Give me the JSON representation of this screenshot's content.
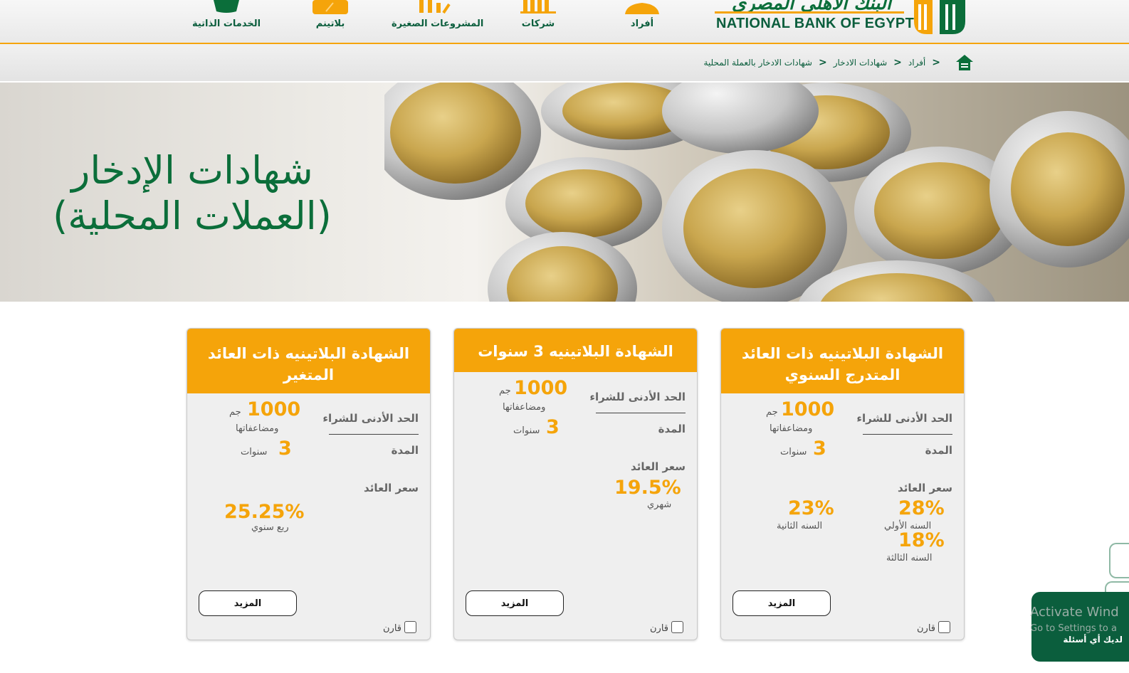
{
  "nav": {
    "items": [
      {
        "label": "الخدمات الذاتية",
        "icon": "self-service-icon"
      },
      {
        "label": "بلاتينم",
        "icon": "platinum-icon"
      },
      {
        "label": "المشروعات الصغيرة",
        "icon": "small-business-icon"
      },
      {
        "label": "شركات",
        "icon": "corporate-icon"
      },
      {
        "label": "أفراد",
        "icon": "personal-icon"
      }
    ]
  },
  "logo": {
    "arabic": "البنك الأهلي المصري",
    "english": "NATIONAL BANK OF EGYPT"
  },
  "breadcrumb": {
    "items": [
      "أفراد",
      "شهادات الادخار",
      "شهادات الادخار بالعملة المحلية"
    ],
    "separator": ">"
  },
  "hero": {
    "title_line1": "شهادات الإدخار",
    "title_line2": "(العملات المحلية)"
  },
  "cards": [
    {
      "title_line1": "الشهادة البلاتينيه ذات العائد",
      "title_line2": "المتدرج السنوي",
      "min_label": "الحد الأدنى للشراء",
      "min_value": "1000",
      "min_unit": "جم",
      "min_note": "ومضاعفاتها",
      "term_label": "المدة",
      "term_value": "3",
      "term_unit": "سنوات",
      "rate_label": "سعر العائد",
      "rates": [
        {
          "value": "28%",
          "note": "السنه الأولي"
        },
        {
          "value": "23%",
          "note": "السنه الثانية"
        },
        {
          "value": "18%",
          "note": "السنه الثالثة"
        }
      ],
      "more_label": "المزيد",
      "compare_label": "قارن"
    },
    {
      "title_line1": "الشهادة البلاتينيه 3 سنوات",
      "title_line2": "",
      "min_label": "الحد الأدنى للشراء",
      "min_value": "1000",
      "min_unit": "جم",
      "min_note": "ومضاعفاتها",
      "term_label": "المدة",
      "term_value": "3",
      "term_unit": "سنوات",
      "rate_label": "سعر العائد",
      "rates": [
        {
          "value": "19.5%",
          "note": "شهري"
        }
      ],
      "more_label": "المزيد",
      "compare_label": "قارن"
    },
    {
      "title_line1": "الشهادة البلاتينيه ذات العائد",
      "title_line2": "المتغير",
      "min_label": "الحد الأدنى للشراء",
      "min_value": "1000",
      "min_unit": "جم",
      "min_note": "ومضاعفاتها",
      "term_label": "المدة",
      "term_value": "3",
      "term_unit": "سنوات",
      "rate_label": "سعر العائد",
      "rates": [
        {
          "value": "25.25%",
          "note": "ربع سنوي"
        }
      ],
      "more_label": "المزيد",
      "compare_label": "قارن"
    }
  ],
  "chat": {
    "label": "لديك أي أسئلة"
  },
  "watermark": {
    "line1": "Activate Wind",
    "line2": "Go to Settings to a"
  },
  "colors": {
    "brand_green": "#0b5e3d",
    "accent_orange": "#f5a40a",
    "card_bg": "#efefef"
  }
}
